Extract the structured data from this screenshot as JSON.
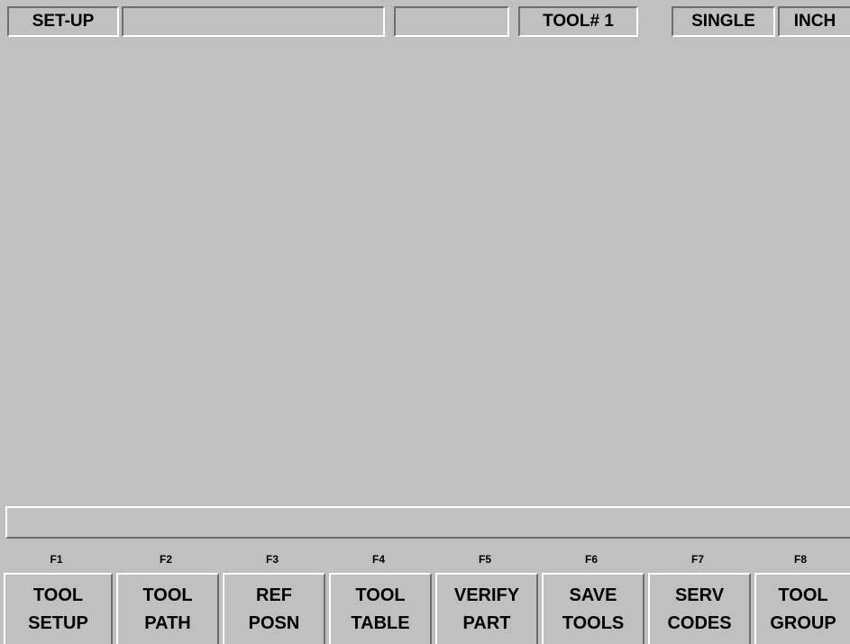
{
  "status_bar": {
    "mode": "SET-UP",
    "field2": "",
    "field3": "",
    "tool": "TOOL# 1",
    "run_mode": "SINGLE",
    "units": "INCH"
  },
  "message_line": "",
  "function_keys": [
    {
      "key": "F1",
      "line1": "TOOL",
      "line2": "SETUP"
    },
    {
      "key": "F2",
      "line1": "TOOL",
      "line2": "PATH"
    },
    {
      "key": "F3",
      "line1": "REF",
      "line2": "POSN"
    },
    {
      "key": "F4",
      "line1": "TOOL",
      "line2": "TABLE"
    },
    {
      "key": "F5",
      "line1": "VERIFY",
      "line2": "PART"
    },
    {
      "key": "F6",
      "line1": "SAVE",
      "line2": "TOOLS"
    },
    {
      "key": "F7",
      "line1": "SERV",
      "line2": "CODES"
    },
    {
      "key": "F8",
      "line1": "TOOL",
      "line2": "GROUP"
    }
  ],
  "colors": {
    "background": "#c0c0c0",
    "highlight": "#ffffff",
    "shadow": "#6e6e6e",
    "text": "#000000"
  }
}
